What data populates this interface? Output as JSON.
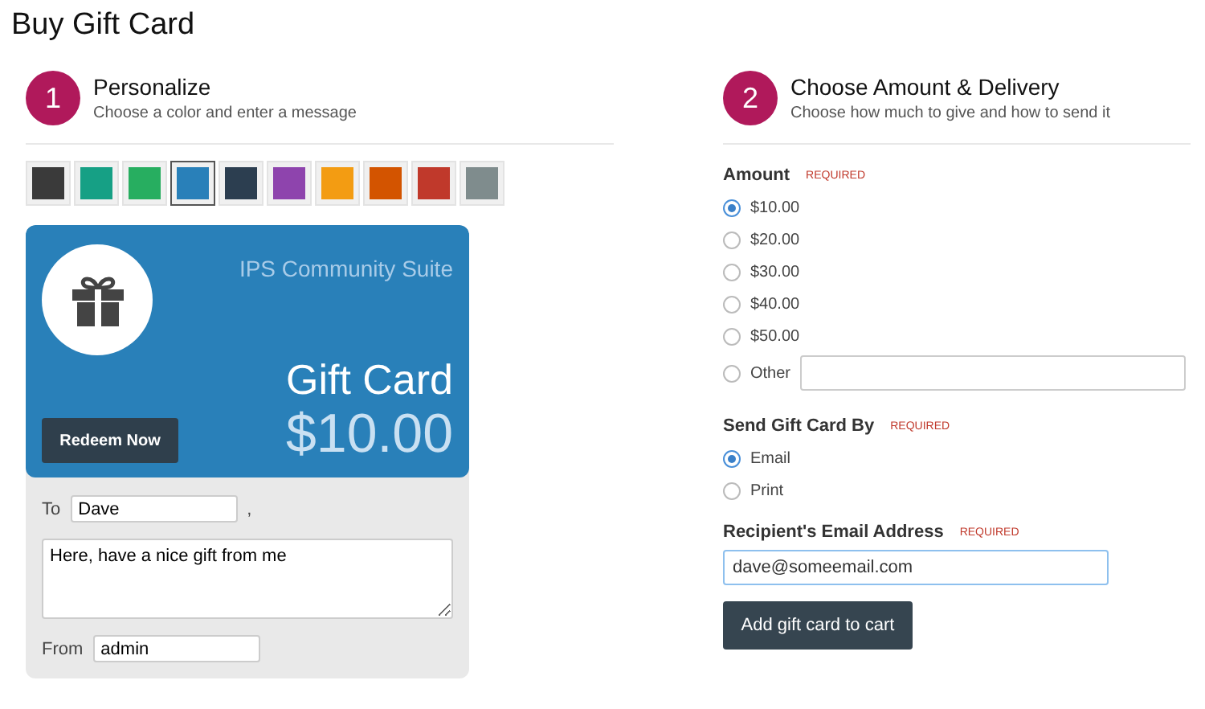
{
  "page_title": "Buy Gift Card",
  "personalize": {
    "step": "1",
    "title": "Personalize",
    "subtitle": "Choose a color and enter a message",
    "swatches": [
      {
        "color": "#3a3a3a",
        "selected": false
      },
      {
        "color": "#16a085",
        "selected": false
      },
      {
        "color": "#27ae60",
        "selected": false
      },
      {
        "color": "#2980b9",
        "selected": true
      },
      {
        "color": "#2c3e50",
        "selected": false
      },
      {
        "color": "#8e44ad",
        "selected": false
      },
      {
        "color": "#f39c12",
        "selected": false
      },
      {
        "color": "#d35400",
        "selected": false
      },
      {
        "color": "#c0392b",
        "selected": false
      },
      {
        "color": "#7f8c8d",
        "selected": false
      }
    ],
    "card": {
      "brand": "IPS Community Suite",
      "title": "Gift Card",
      "amount": "$10.00",
      "redeem_button": "Redeem Now"
    },
    "to_label": "To",
    "to_value": "Dave",
    "comma": ",",
    "message": "Here, have a nice gift from me",
    "from_label": "From",
    "from_value": "admin"
  },
  "delivery": {
    "step": "2",
    "title": "Choose Amount & Delivery",
    "subtitle": "Choose how much to give and how to send it",
    "amount_label": "Amount",
    "required": "REQUIRED",
    "amounts": [
      {
        "label": "$10.00",
        "selected": true
      },
      {
        "label": "$20.00",
        "selected": false
      },
      {
        "label": "$30.00",
        "selected": false
      },
      {
        "label": "$40.00",
        "selected": false
      },
      {
        "label": "$50.00",
        "selected": false
      }
    ],
    "other": {
      "label": "Other",
      "selected": false
    },
    "send_label": "Send Gift Card By",
    "send_required": "REQUIRED",
    "methods": [
      {
        "label": "Email",
        "selected": true
      },
      {
        "label": "Print",
        "selected": false
      }
    ],
    "email_label": "Recipient's Email Address",
    "email_required": "REQUIRED",
    "email_value": "dave@someemail.com",
    "submit": "Add gift card to cart"
  }
}
